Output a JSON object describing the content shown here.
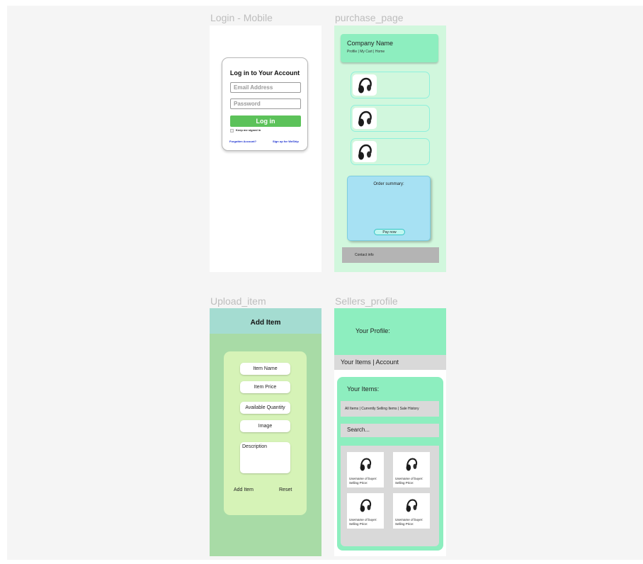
{
  "frames": {
    "login": {
      "label": "Login - Mobile",
      "title": "Log in to Your Account",
      "email_placeholder": "Email Address",
      "password_placeholder": "Password",
      "login_button": "Log in",
      "keep_signed_in": "Keep me signed in",
      "forgotten_link": "Forgotten Account?",
      "signup_link": "Sign up for WeShip"
    },
    "purchase": {
      "label": "purchase_page",
      "company_name": "Company Name",
      "nav": "Profile | My Cart | Home",
      "products": [
        {
          "icon": "headphones-icon"
        },
        {
          "icon": "headphones-icon"
        },
        {
          "icon": "headphones-icon"
        }
      ],
      "order_summary": "Order summary:",
      "pay_button": "Pay now",
      "contact": "Contact info"
    },
    "upload": {
      "label": "Upload_item",
      "title": "Add Item",
      "fields": [
        "Item Name",
        "Item Price",
        "Available Quantity",
        "Image"
      ],
      "description": "Description",
      "add_button": "Add Item",
      "reset_button": "Reset"
    },
    "sellers": {
      "label": "Sellers_profile",
      "profile_title": "Your Profile:",
      "nav": "Your Items | Account",
      "items_title": "Your Items:",
      "filters": "All Items | Currently Selling Items | Sale History",
      "search": "Search...",
      "items": [
        {
          "buyer": "Username of buyer:",
          "price": "Selling Price:"
        },
        {
          "buyer": "Username of buyer:",
          "price": "Selling Price:"
        },
        {
          "buyer": "Username of buyer:",
          "price": "Selling Price:"
        },
        {
          "buyer": "Username of buyer:",
          "price": "Selling Price:"
        }
      ]
    }
  },
  "colors": {
    "login_button": "#5cc25a",
    "mint_header": "#8deebf",
    "purchase_bg": "#d1f7dd",
    "order_box": "#a7e1f3",
    "upload_bg": "#a8dba6",
    "upload_panel": "#d6f3b7",
    "link_blue": "#1a2fd0"
  }
}
